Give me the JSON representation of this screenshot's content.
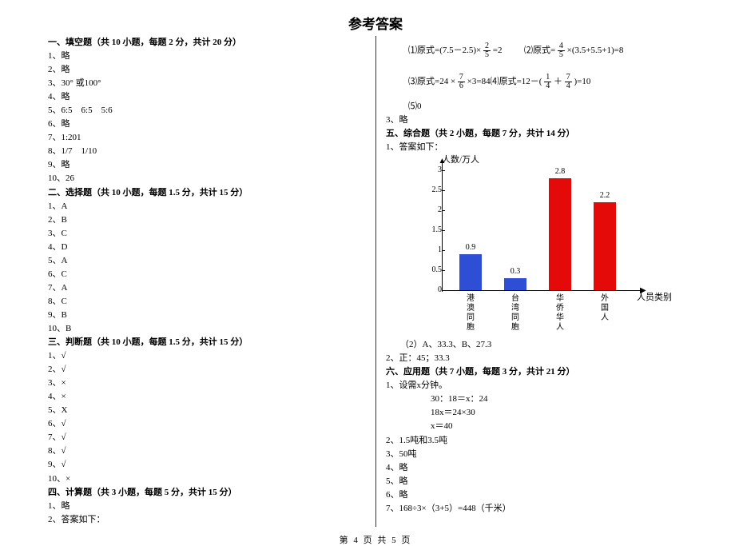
{
  "title": "参考答案",
  "fill": {
    "header": "一、填空题（共 10 小题，每题 2 分，共计 20 分）",
    "a1": "1、略",
    "a2": "2、略",
    "a3": "3、30° 或100°",
    "a4": "4、略",
    "a5": "5、6:5    6:5    5:6",
    "a6": "6、略",
    "a7": "7、1:201",
    "a8": "8、1/7    1/10",
    "a9": "9、略",
    "a10": "10、26"
  },
  "choice": {
    "header": "二、选择题（共 10 小题，每题 1.5 分，共计 15 分）",
    "a1": "1、A",
    "a2": "2、B",
    "a3": "3、C",
    "a4": "4、D",
    "a5": "5、A",
    "a6": "6、C",
    "a7": "7、A",
    "a8": "8、C",
    "a9": "9、B",
    "a10": "10、B"
  },
  "judge": {
    "header": "三、判断题（共 10 小题，每题 1.5 分，共计 15 分）",
    "a1": "1、√",
    "a2": "2、√",
    "a3": "3、×",
    "a4": "4、×",
    "a5": "5、X",
    "a6": "6、√",
    "a7": "7、√",
    "a8": "8、√",
    "a9": "9、√",
    "a10": "10、×"
  },
  "calc": {
    "header": "四、计算题（共 3 小题，每题 5 分，共计 15 分）",
    "a1": "1、略",
    "a2": "2、答案如下：",
    "r1a": "⑴原式=(7.5－2.5)×",
    "r1frN": "2",
    "r1frD": "5",
    "r1b": "=2",
    "r2a": "⑵原式=",
    "r2frN": "4",
    "r2frD": "5",
    "r2b": "×(3.5+5.5+1)=8",
    "r3a": "⑶原式=24 ×",
    "r3frN": "7",
    "r3frD": "6",
    "r3b": "×3=84",
    "r4a": "⑷原式=12－(",
    "r4fr1N": "1",
    "r4fr1D": "4",
    "r4mid": "＋",
    "r4fr2N": "7",
    "r4fr2D": "4",
    "r4b": ")=10",
    "r5": "⑸0",
    "a3": "3、略"
  },
  "comp": {
    "header": "五、综合题（共 2 小题，每题 7 分，共计 14 分）",
    "a1": "1、答案如下：",
    "chart_note": "（2）A、33.3、B、27.3",
    "a2": "2、正：45；33.3"
  },
  "chart_data": {
    "type": "bar",
    "ylabel": "人数/万人",
    "xlabel": "人员类别",
    "ylim": [
      0,
      3
    ],
    "yticks": [
      0,
      0.5,
      1,
      1.5,
      2,
      2.5,
      3
    ],
    "categories": [
      "港澳同胞",
      "台湾同胞",
      "华侨华人",
      "外国人"
    ],
    "values": [
      0.9,
      0.3,
      2.8,
      2.2
    ],
    "colors": [
      "blue",
      "blue",
      "red",
      "red"
    ]
  },
  "app": {
    "header": "六、应用题（共 7 小题，每题 3 分，共计 21 分）",
    "a1": "1、设需x分钟。",
    "a1s1": "30：18＝x：24",
    "a1s2": "18x＝24×30",
    "a1s3": "x＝40",
    "a2": "2、1.5吨和3.5吨",
    "a3": "3、50吨",
    "a4": "4、略",
    "a5": "5、略",
    "a6": "6、略",
    "a7": "7、168÷3×（3+5）=448（千米）"
  },
  "footer": "第 4 页 共 5 页"
}
